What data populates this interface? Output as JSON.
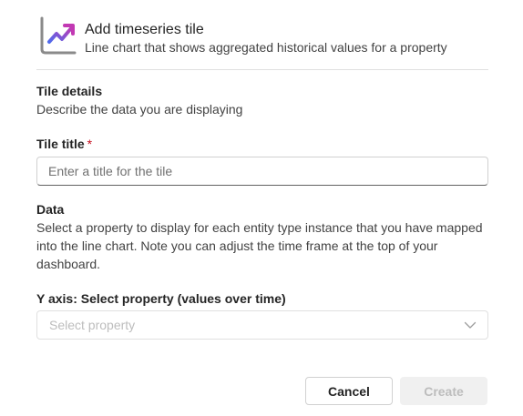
{
  "header": {
    "icon": "line-chart-trend-icon",
    "title": "Add timeseries tile",
    "subtitle": "Line chart that shows aggregated historical values for a property"
  },
  "tile_details": {
    "title": "Tile details",
    "description": "Describe the data you are displaying"
  },
  "tile_title_field": {
    "label": "Tile title",
    "required_marker": "*",
    "value": "",
    "placeholder": "Enter a title for the tile"
  },
  "data_section": {
    "title": "Data",
    "description": "Select a property to display for each entity type instance that you have mapped into the line chart. Note you can adjust the time frame at the top of your dashboard."
  },
  "y_axis_field": {
    "label": "Y axis: Select property (values over time)",
    "placeholder": "Select property",
    "icon": "chevron-down-icon"
  },
  "footer": {
    "cancel_label": "Cancel",
    "create_label": "Create"
  },
  "colors": {
    "accent_gradient_start": "#4f6bed",
    "accent_gradient_end": "#c239b3",
    "required": "#c50f1f",
    "disabled_text": "#bdbdbd"
  }
}
